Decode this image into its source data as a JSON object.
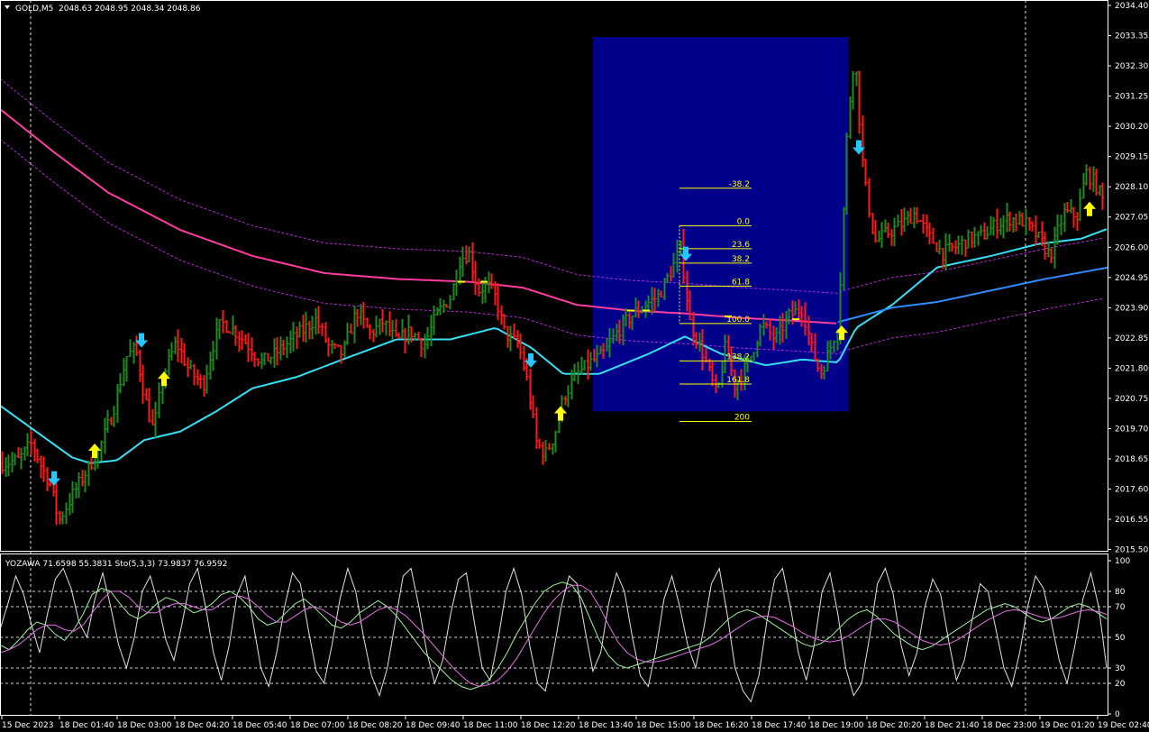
{
  "symbol_header": {
    "label": "GOLD,M5",
    "ohlc": "2048.63 2048.95 2048.34 2048.86"
  },
  "indicator_header": {
    "label": "YOZAWA 71.6598 55.3831  Sto(5,3,3) 73.9837 76.9592"
  },
  "colors": {
    "background": "#000000",
    "bull_bar": "#1f8a1f",
    "bear_bar": "#ff1a1a",
    "ma_pink": "#ff3d9e",
    "band_purple": "#b02ad0",
    "ma_cyan": "#35e0f5",
    "ma_blue": "#2f8cff",
    "zone_fill": "#00008b",
    "fib_color": "#ffff00",
    "arrow_up": "#ffff00",
    "arrow_down": "#22c8ff"
  },
  "chart_data": {
    "type": "candlestick",
    "price_axis": {
      "range": [
        2015.55,
        2034.4
      ],
      "ticks": [
        "2034.40",
        "2033.35",
        "2032.30",
        "2031.25",
        "2030.20",
        "2029.15",
        "2028.10",
        "2027.05",
        "2026.00",
        "2024.95",
        "2023.90",
        "2022.85",
        "2021.80",
        "2020.75",
        "2019.70",
        "2018.65",
        "2017.60",
        "2016.55",
        "2015.50"
      ]
    },
    "time_axis": {
      "ticks": [
        "15 Dec 2023",
        "18 Dec 01:40",
        "18 Dec 03:00",
        "18 Dec 04:20",
        "18 Dec 05:40",
        "18 Dec 07:00",
        "18 Dec 08:20",
        "18 Dec 09:40",
        "18 Dec 11:00",
        "18 Dec 12:20",
        "18 Dec 13:40",
        "18 Dec 15:00",
        "18 Dec 16:20",
        "18 Dec 17:40",
        "18 Dec 19:00",
        "18 Dec 20:20",
        "18 Dec 21:40",
        "18 Dec 23:00",
        "19 Dec 01:20",
        "19 Dec 02:40"
      ]
    },
    "price_path": [
      [
        0,
        2018.5
      ],
      [
        20,
        2018.6
      ],
      [
        35,
        2019.2
      ],
      [
        45,
        2018.4
      ],
      [
        55,
        2017.8
      ],
      [
        65,
        2016.5
      ],
      [
        80,
        2017.4
      ],
      [
        95,
        2018.2
      ],
      [
        110,
        2019.0
      ],
      [
        125,
        2020.3
      ],
      [
        140,
        2022.2
      ],
      [
        150,
        2022.5
      ],
      [
        160,
        2020.8
      ],
      [
        170,
        2019.6
      ],
      [
        180,
        2021.5
      ],
      [
        195,
        2022.7
      ],
      [
        210,
        2021.7
      ],
      [
        225,
        2021.2
      ],
      [
        235,
        2022.5
      ],
      [
        245,
        2023.4
      ],
      [
        260,
        2023.1
      ],
      [
        275,
        2022.6
      ],
      [
        290,
        2022.0
      ],
      [
        305,
        2022.3
      ],
      [
        320,
        2022.7
      ],
      [
        335,
        2023.1
      ],
      [
        350,
        2023.5
      ],
      [
        365,
        2022.5
      ],
      [
        380,
        2022.3
      ],
      [
        395,
        2023.8
      ],
      [
        410,
        2023.0
      ],
      [
        425,
        2023.4
      ],
      [
        440,
        2022.7
      ],
      [
        455,
        2023.1
      ],
      [
        470,
        2022.6
      ],
      [
        485,
        2023.7
      ],
      [
        500,
        2024.3
      ],
      [
        510,
        2025.6
      ],
      [
        520,
        2025.8
      ],
      [
        530,
        2024.5
      ],
      [
        540,
        2024.7
      ],
      [
        550,
        2024.2
      ],
      [
        560,
        2023.0
      ],
      [
        575,
        2022.6
      ],
      [
        585,
        2021.3
      ],
      [
        595,
        2019.2
      ],
      [
        605,
        2018.8
      ],
      [
        615,
        2019.5
      ],
      [
        625,
        2020.8
      ],
      [
        640,
        2021.6
      ],
      [
        655,
        2022.0
      ],
      [
        670,
        2022.3
      ],
      [
        685,
        2023.1
      ],
      [
        700,
        2023.6
      ],
      [
        715,
        2024.0
      ],
      [
        730,
        2024.3
      ],
      [
        745,
        2025.2
      ],
      [
        755,
        2026.0
      ],
      [
        765,
        2023.4
      ],
      [
        780,
        2022.3
      ],
      [
        795,
        2020.8
      ],
      [
        805,
        2022.6
      ],
      [
        815,
        2021.2
      ],
      [
        830,
        2022.0
      ],
      [
        845,
        2023.3
      ],
      [
        860,
        2022.8
      ],
      [
        875,
        2023.6
      ],
      [
        890,
        2023.9
      ],
      [
        900,
        2022.5
      ],
      [
        910,
        2021.6
      ],
      [
        920,
        2022.4
      ],
      [
        930,
        2023.4
      ],
      [
        940,
        2030.3
      ],
      [
        948,
        2032.8
      ],
      [
        958,
        2028.5
      ],
      [
        970,
        2026.2
      ],
      [
        985,
        2026.5
      ],
      [
        1000,
        2026.8
      ],
      [
        1015,
        2027.2
      ],
      [
        1030,
        2026.4
      ],
      [
        1045,
        2025.8
      ],
      [
        1060,
        2026.0
      ],
      [
        1075,
        2026.3
      ],
      [
        1090,
        2026.4
      ],
      [
        1105,
        2026.8
      ],
      [
        1120,
        2027.0
      ],
      [
        1135,
        2026.9
      ],
      [
        1150,
        2026.4
      ],
      [
        1165,
        2025.7
      ],
      [
        1180,
        2027.2
      ],
      [
        1195,
        2027.1
      ],
      [
        1205,
        2028.6
      ],
      [
        1215,
        2028.2
      ],
      [
        1230,
        2027.2
      ]
    ],
    "moving_averages": [
      {
        "color": "#ff3d9e",
        "points": [
          [
            0,
            2030.8
          ],
          [
            60,
            2029.3
          ],
          [
            120,
            2027.9
          ],
          [
            200,
            2026.6
          ],
          [
            280,
            2025.7
          ],
          [
            360,
            2025.1
          ],
          [
            440,
            2024.9
          ],
          [
            520,
            2024.8
          ],
          [
            580,
            2024.6
          ],
          [
            640,
            2024.0
          ],
          [
            700,
            2023.8
          ],
          [
            760,
            2023.7
          ],
          [
            820,
            2023.55
          ],
          [
            880,
            2023.45
          ],
          [
            930,
            2023.35
          ]
        ]
      },
      {
        "color": "#35e0f5",
        "points": [
          [
            0,
            2020.5
          ],
          [
            40,
            2019.6
          ],
          [
            80,
            2018.7
          ],
          [
            100,
            2018.5
          ],
          [
            130,
            2018.6
          ],
          [
            160,
            2019.3
          ],
          [
            200,
            2019.6
          ],
          [
            240,
            2020.3
          ],
          [
            280,
            2021.1
          ],
          [
            330,
            2021.5
          ],
          [
            380,
            2022.1
          ],
          [
            440,
            2022.8
          ],
          [
            500,
            2022.8
          ],
          [
            550,
            2023.2
          ],
          [
            590,
            2022.5
          ],
          [
            625,
            2021.6
          ],
          [
            665,
            2021.6
          ],
          [
            720,
            2022.3
          ],
          [
            760,
            2022.9
          ],
          [
            800,
            2022.3
          ],
          [
            850,
            2021.9
          ],
          [
            890,
            2022.1
          ],
          [
            930,
            2022.0
          ],
          [
            950,
            2023.2
          ],
          [
            990,
            2024.0
          ],
          [
            1040,
            2025.3
          ],
          [
            1100,
            2025.7
          ],
          [
            1150,
            2026.1
          ],
          [
            1200,
            2026.3
          ],
          [
            1230,
            2026.65
          ]
        ]
      },
      {
        "color": "#2f8cff",
        "points": [
          [
            930,
            2023.4
          ],
          [
            990,
            2023.9
          ],
          [
            1040,
            2024.1
          ],
          [
            1100,
            2024.5
          ],
          [
            1160,
            2024.9
          ],
          [
            1230,
            2025.3
          ]
        ]
      }
    ],
    "fibonacci": {
      "levels": [
        {
          "label": "-38.2",
          "value": 2028.05
        },
        {
          "label": "0.0",
          "value": 2026.75
        },
        {
          "label": "23.6",
          "value": 2025.95
        },
        {
          "label": "38.2",
          "value": 2025.45
        },
        {
          "label": "61.8",
          "value": 2024.65
        },
        {
          "label": "100.0",
          "value": 2023.35
        },
        {
          "label": "138.2",
          "value": 2022.05
        },
        {
          "label": "161.8",
          "value": 2021.25
        },
        {
          "label": "200",
          "value": 2019.95
        }
      ]
    },
    "signals": [
      {
        "dir": "down",
        "t": 60,
        "price": 2018.0
      },
      {
        "dir": "up",
        "t": 105,
        "price": 2018.9
      },
      {
        "dir": "down",
        "t": 157,
        "price": 2022.8
      },
      {
        "dir": "up",
        "t": 182,
        "price": 2021.4
      },
      {
        "dir": "down",
        "t": 589,
        "price": 2022.1
      },
      {
        "dir": "up",
        "t": 622,
        "price": 2020.2
      },
      {
        "dir": "down",
        "t": 761,
        "price": 2025.8
      },
      {
        "dir": "up",
        "t": 934,
        "price": 2023.0
      },
      {
        "dir": "down",
        "t": 953,
        "price": 2029.5
      },
      {
        "dir": "up",
        "t": 1209,
        "price": 2027.3
      }
    ],
    "oscillator": {
      "type": "line",
      "ylim": [
        0,
        100
      ],
      "ticks": [
        "100",
        "80",
        "70",
        "50",
        "30",
        "20",
        "0"
      ],
      "levels": [
        80,
        70,
        50,
        30,
        20
      ],
      "series": [
        {
          "name": "YOZAWA",
          "color": "#e0e0e0",
          "values": [
            55,
            72,
            90,
            78,
            58,
            40,
            65,
            88,
            95,
            82,
            60,
            50,
            75,
            92,
            70,
            45,
            30,
            50,
            80,
            90,
            72,
            48,
            35,
            58,
            85,
            95,
            70,
            40,
            22,
            45,
            78,
            90,
            60,
            30,
            18,
            40,
            70,
            92,
            85,
            55,
            28,
            20,
            45,
            75,
            95,
            80,
            50,
            25,
            12,
            30,
            60,
            90,
            95,
            70,
            40,
            20,
            35,
            65,
            88,
            92,
            60,
            30,
            22,
            48,
            80,
            95,
            78,
            45,
            20,
            15,
            40,
            70,
            90,
            85,
            55,
            28,
            40,
            72,
            92,
            80,
            50,
            25,
            18,
            42,
            75,
            90,
            70,
            45,
            30,
            55,
            85,
            95,
            65,
            30,
            15,
            8,
            25,
            60,
            88,
            95,
            70,
            40,
            22,
            45,
            80,
            92,
            65,
            30,
            12,
            20,
            50,
            85,
            95,
            78,
            45,
            25,
            40,
            70,
            88,
            78,
            48,
            22,
            35,
            62,
            85,
            80,
            55,
            30,
            18,
            40,
            70,
            90,
            82,
            60,
            35,
            20,
            45,
            75,
            92,
            70,
            30
          ]
        },
        {
          "name": "Sto main",
          "color": "#9ef09e",
          "values": [
            45,
            42,
            48,
            55,
            60,
            58,
            52,
            48,
            55,
            65,
            78,
            82,
            80,
            72,
            65,
            62,
            66,
            72,
            76,
            74,
            70,
            66,
            68,
            72,
            78,
            80,
            76,
            70,
            62,
            58,
            60,
            66,
            72,
            75,
            70,
            64,
            58,
            56,
            60,
            66,
            70,
            74,
            70,
            64,
            56,
            48,
            40,
            34,
            28,
            22,
            18,
            16,
            18,
            22,
            30,
            40,
            52,
            62,
            72,
            80,
            84,
            86,
            84,
            76,
            62,
            48,
            38,
            32,
            30,
            32,
            34,
            36,
            38,
            40,
            42,
            44,
            46,
            50,
            56,
            62,
            66,
            68,
            66,
            62,
            58,
            54,
            50,
            46,
            44,
            46,
            50,
            56,
            62,
            66,
            68,
            64,
            58,
            52,
            48,
            44,
            42,
            44,
            48,
            52,
            56,
            60,
            64,
            68,
            70,
            72,
            70,
            66,
            62,
            60,
            62,
            66,
            70,
            72,
            70,
            66,
            62
          ]
        },
        {
          "name": "Sto signal",
          "color": "#e070e0",
          "values": [
            40,
            42,
            45,
            50,
            55,
            58,
            58,
            55,
            54,
            58,
            66,
            74,
            80,
            80,
            76,
            70,
            66,
            66,
            70,
            72,
            72,
            70,
            68,
            68,
            72,
            76,
            77,
            75,
            70,
            64,
            60,
            60,
            64,
            68,
            70,
            68,
            64,
            60,
            58,
            60,
            64,
            68,
            70,
            68,
            64,
            58,
            52,
            45,
            38,
            31,
            25,
            20,
            18,
            19,
            22,
            28,
            36,
            46,
            56,
            66,
            74,
            80,
            84,
            84,
            80,
            70,
            58,
            47,
            40,
            36,
            34,
            34,
            35,
            37,
            39,
            41,
            43,
            45,
            48,
            52,
            56,
            60,
            63,
            64,
            63,
            60,
            57,
            53,
            50,
            48,
            47,
            48,
            51,
            55,
            59,
            62,
            62,
            60,
            56,
            52,
            48,
            46,
            45,
            46,
            49,
            53,
            57,
            61,
            64,
            67,
            68,
            67,
            65,
            63,
            62,
            63,
            65,
            67,
            68,
            67,
            65
          ]
        }
      ]
    }
  }
}
